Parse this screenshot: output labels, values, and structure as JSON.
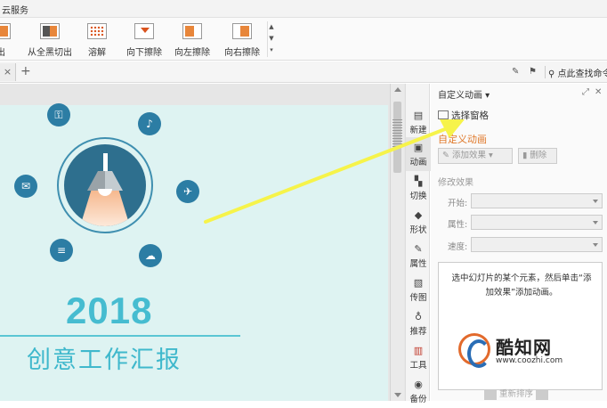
{
  "titlebar": {
    "label": "云服务"
  },
  "ribbon": {
    "items": [
      {
        "label": "出",
        "icon": "fly-out-icon"
      },
      {
        "label": "从全黑切出",
        "icon": "cut-from-black-icon"
      },
      {
        "label": "溶解",
        "icon": "dissolve-icon"
      },
      {
        "label": "向下擦除",
        "icon": "wipe-down-icon"
      },
      {
        "label": "向左擦除",
        "icon": "wipe-left-icon"
      },
      {
        "label": "向右擦除",
        "icon": "wipe-right-icon"
      }
    ]
  },
  "tabs": {
    "close": "×",
    "add": "+"
  },
  "search": {
    "label": "点此查找命令"
  },
  "slide": {
    "year": "2018",
    "subtitle": "创意工作汇报",
    "orbit_icons": [
      "lock-icon",
      "speaker-icon",
      "chat-icon",
      "bird-icon",
      "settings-sliders-icon",
      "cloud-upload-icon"
    ]
  },
  "strip": {
    "items": [
      {
        "label": "新建",
        "icon": "new-doc-icon"
      },
      {
        "label": "动画",
        "icon": "animation-icon"
      },
      {
        "label": "切换",
        "icon": "transition-icon"
      },
      {
        "label": "形状",
        "icon": "shape-icon"
      },
      {
        "label": "属性",
        "icon": "properties-icon"
      },
      {
        "label": "传图",
        "icon": "upload-image-icon"
      },
      {
        "label": "推荐",
        "icon": "recommend-icon"
      },
      {
        "label": "工具",
        "icon": "toolbox-icon"
      },
      {
        "label": "备份",
        "icon": "backup-icon"
      }
    ]
  },
  "panel": {
    "title": "自定义动画 ▾",
    "select_pane": "选择窗格",
    "section_title": "自定义动画",
    "add_effect": "添加效果",
    "delete": "删除",
    "modify_title": "修改效果",
    "fields": [
      {
        "label": "开始:"
      },
      {
        "label": "属性:"
      },
      {
        "label": "速度:"
      }
    ],
    "hint": "选中幻灯片的某个元素，然后单击“添加效果”添加动画。",
    "reorder": "重新排序"
  },
  "watermark": {
    "name": "酷知网",
    "url": "www.coozhi.com"
  },
  "colors": {
    "accent": "#e07a2c",
    "slide_bg": "#def3f2",
    "title": "#46bcd0",
    "arrow": "#f6f34a"
  }
}
